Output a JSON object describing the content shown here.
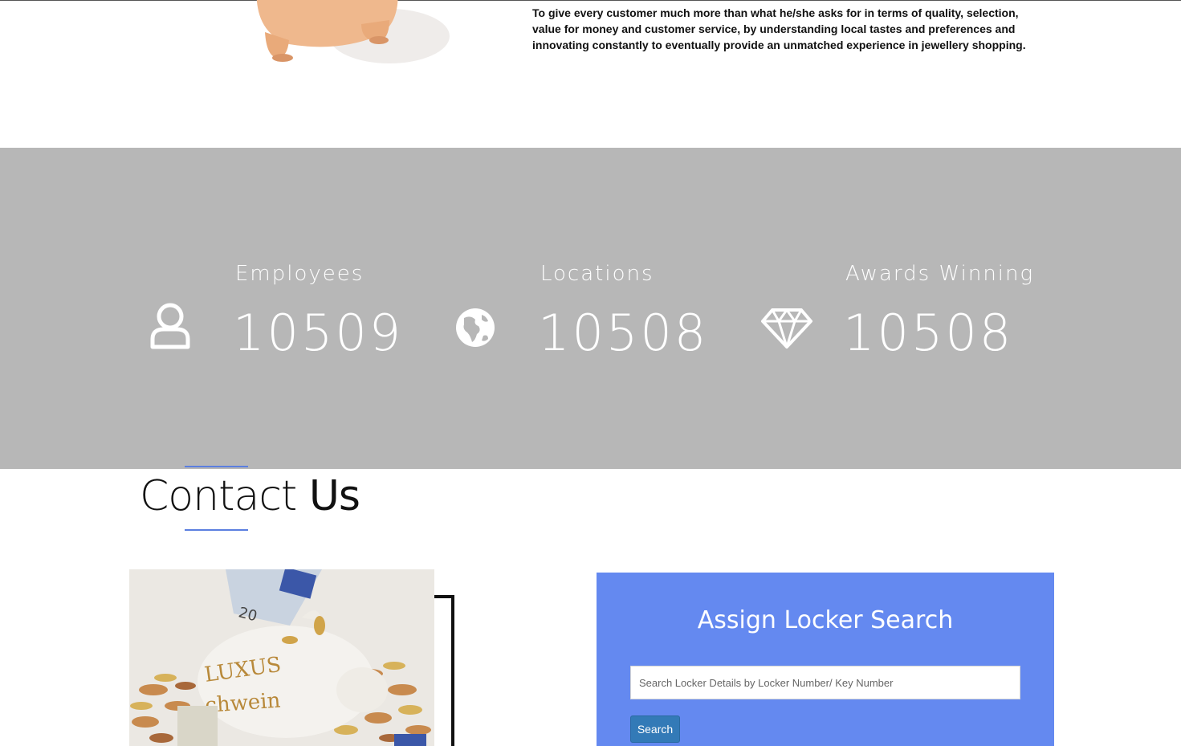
{
  "mission": {
    "text": "To give every customer much more than what he/she asks for in terms of quality, selection, value for money and customer service, by understanding local tastes and preferences and innovating constantly to eventually provide an unmatched experience in jewellery shopping."
  },
  "stats": [
    {
      "label": "Employees",
      "value": "10509",
      "icon": "user-icon"
    },
    {
      "label": "Locations",
      "value": "10508",
      "icon": "globe-icon"
    },
    {
      "label": "Awards Winning",
      "value": "10508",
      "icon": "diamond-icon"
    }
  ],
  "contact": {
    "title_light": "Contact ",
    "title_bold": "Us"
  },
  "locker_search": {
    "title": "Assign Locker Search",
    "placeholder": "Search Locker Details by Locker Number/ Key Number",
    "button_label": "Search"
  },
  "colors": {
    "stats_band": "#b7b7b7",
    "panel_blue": "#6489f0",
    "button_blue": "#337ab7",
    "accent_rule": "#5b7fe0"
  }
}
